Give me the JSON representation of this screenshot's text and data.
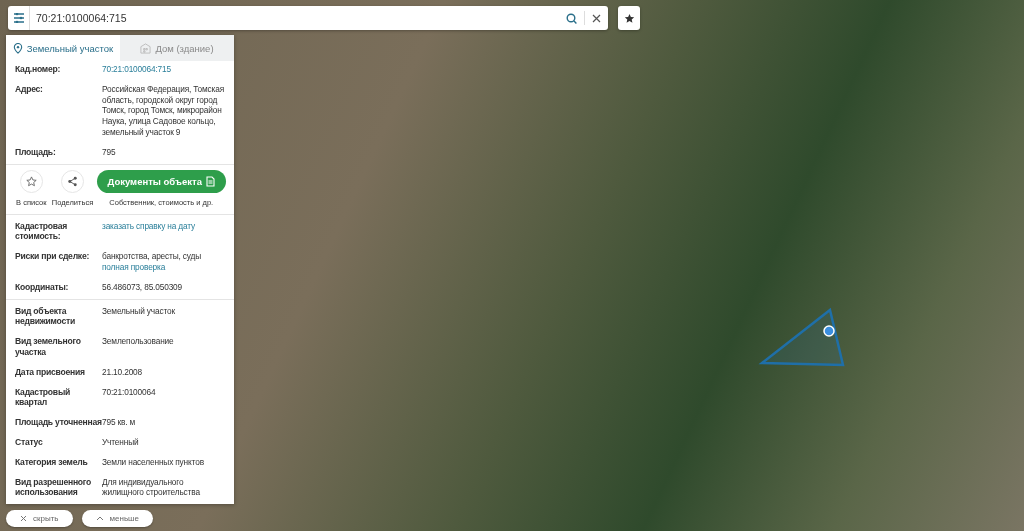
{
  "search": {
    "value": "70:21:0100064:715"
  },
  "tabs": [
    {
      "label": "Земельный участок",
      "selected": true,
      "disabled": false
    },
    {
      "label": "Дом (здание)",
      "selected": false,
      "disabled": true
    }
  ],
  "sections": [
    {
      "rows": [
        {
          "label": "Кад.номер:",
          "link": "70:21:0100064:715"
        },
        {
          "label": "Адрес:",
          "value": "Российская Федерация, Томская область, городской округ город Томск, город Томск, микрорайон Наука, улица Садовое кольцо, земельный участок 9"
        },
        {
          "label": "Площадь:",
          "value": "795"
        }
      ]
    },
    {
      "rows": [
        {
          "label": "Кадастровая стоимость:",
          "link": "заказать справку на дату"
        },
        {
          "label": "Риски при сделке:",
          "value": "банкротства, аресты, суды",
          "link": "полная проверка"
        },
        {
          "label": "Координаты:",
          "value": "56.486073, 85.050309"
        }
      ]
    },
    {
      "rows": [
        {
          "label": "Вид объекта недвижимости",
          "value": "Земельный участок"
        },
        {
          "label": "Вид земельного участка",
          "value": "Землепользование"
        },
        {
          "label": "Дата присвоения",
          "value": "21.10.2008"
        },
        {
          "label": "Кадастровый квартал",
          "value": "70:21:0100064"
        },
        {
          "label": "Площадь уточненная",
          "value": "795 кв. м"
        },
        {
          "label": "Статус",
          "value": "Учтенный"
        },
        {
          "label": "Категория земель",
          "value": "Земли населенных пунктов"
        },
        {
          "label": "Вид разрешенного использования",
          "value": "Для индивидуального жилищного строительства"
        }
      ]
    }
  ],
  "actions": [
    {
      "label": "В список",
      "kind": "star"
    },
    {
      "label": "Поделиться",
      "kind": "share"
    }
  ],
  "documents": {
    "label": "Документы объекта",
    "caption": "Собственник, стоимость и др."
  },
  "bottom_buttons": [
    {
      "label": "скрыть",
      "kind": "close"
    },
    {
      "label": "меньше",
      "kind": "collapse"
    }
  ]
}
